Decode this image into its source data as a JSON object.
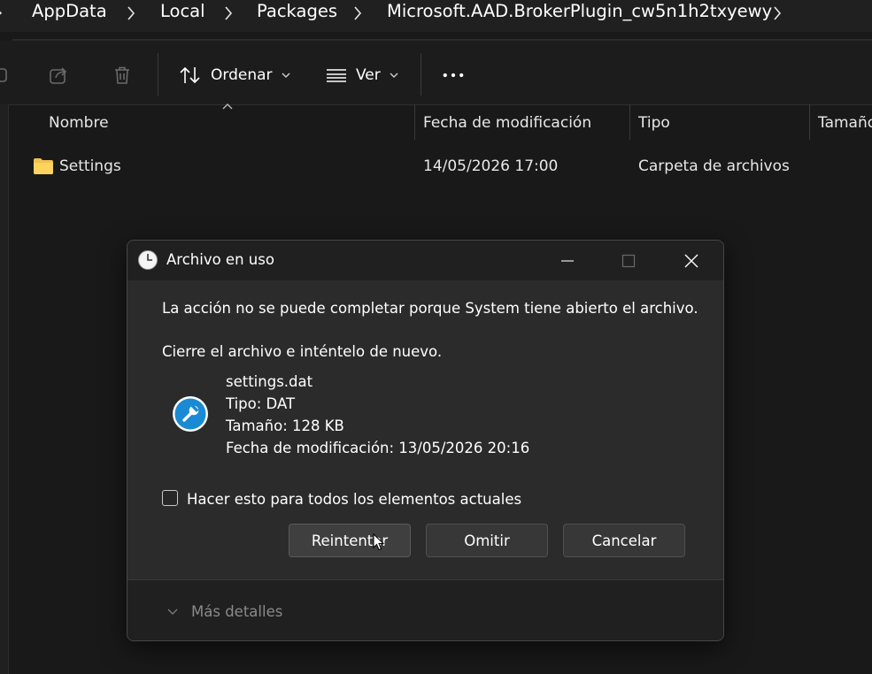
{
  "breadcrumb": {
    "items": [
      "AppData",
      "Local",
      "Packages",
      "Microsoft.AAD.BrokerPlugin_cw5n1h2txyewy"
    ]
  },
  "toolbar": {
    "sort_label": "Ordenar",
    "view_label": "Ver"
  },
  "columns": {
    "name": "Nombre",
    "modified": "Fecha de modificación",
    "type": "Tipo",
    "size": "Tamaño"
  },
  "rows": [
    {
      "name": "Settings",
      "modified": "14/05/2026 17:00",
      "type": "Carpeta de archivos",
      "icon": "folder-icon"
    }
  ],
  "dialog": {
    "title": "Archivo en uso",
    "message": "La acción no se puede completar porque System tiene abierto el archivo.",
    "instruction": "Cierre el archivo e inténtelo de nuevo.",
    "file": {
      "name": "settings.dat",
      "type": "Tipo: DAT",
      "size": "Tamaño: 128 KB",
      "modified": "Fecha de modificación: 13/05/2026 20:16"
    },
    "checkbox_label": "Hacer esto para todos los elementos actuales",
    "checkbox_checked": false,
    "buttons": {
      "retry": "Reintentar",
      "skip": "Omitir",
      "cancel": "Cancelar"
    },
    "more_details": "Más detalles"
  },
  "colors": {
    "background": "#191919",
    "dialog": "#2b2b2b",
    "accent_blue": "#1a8ad4",
    "folder": "#f2c14e"
  }
}
